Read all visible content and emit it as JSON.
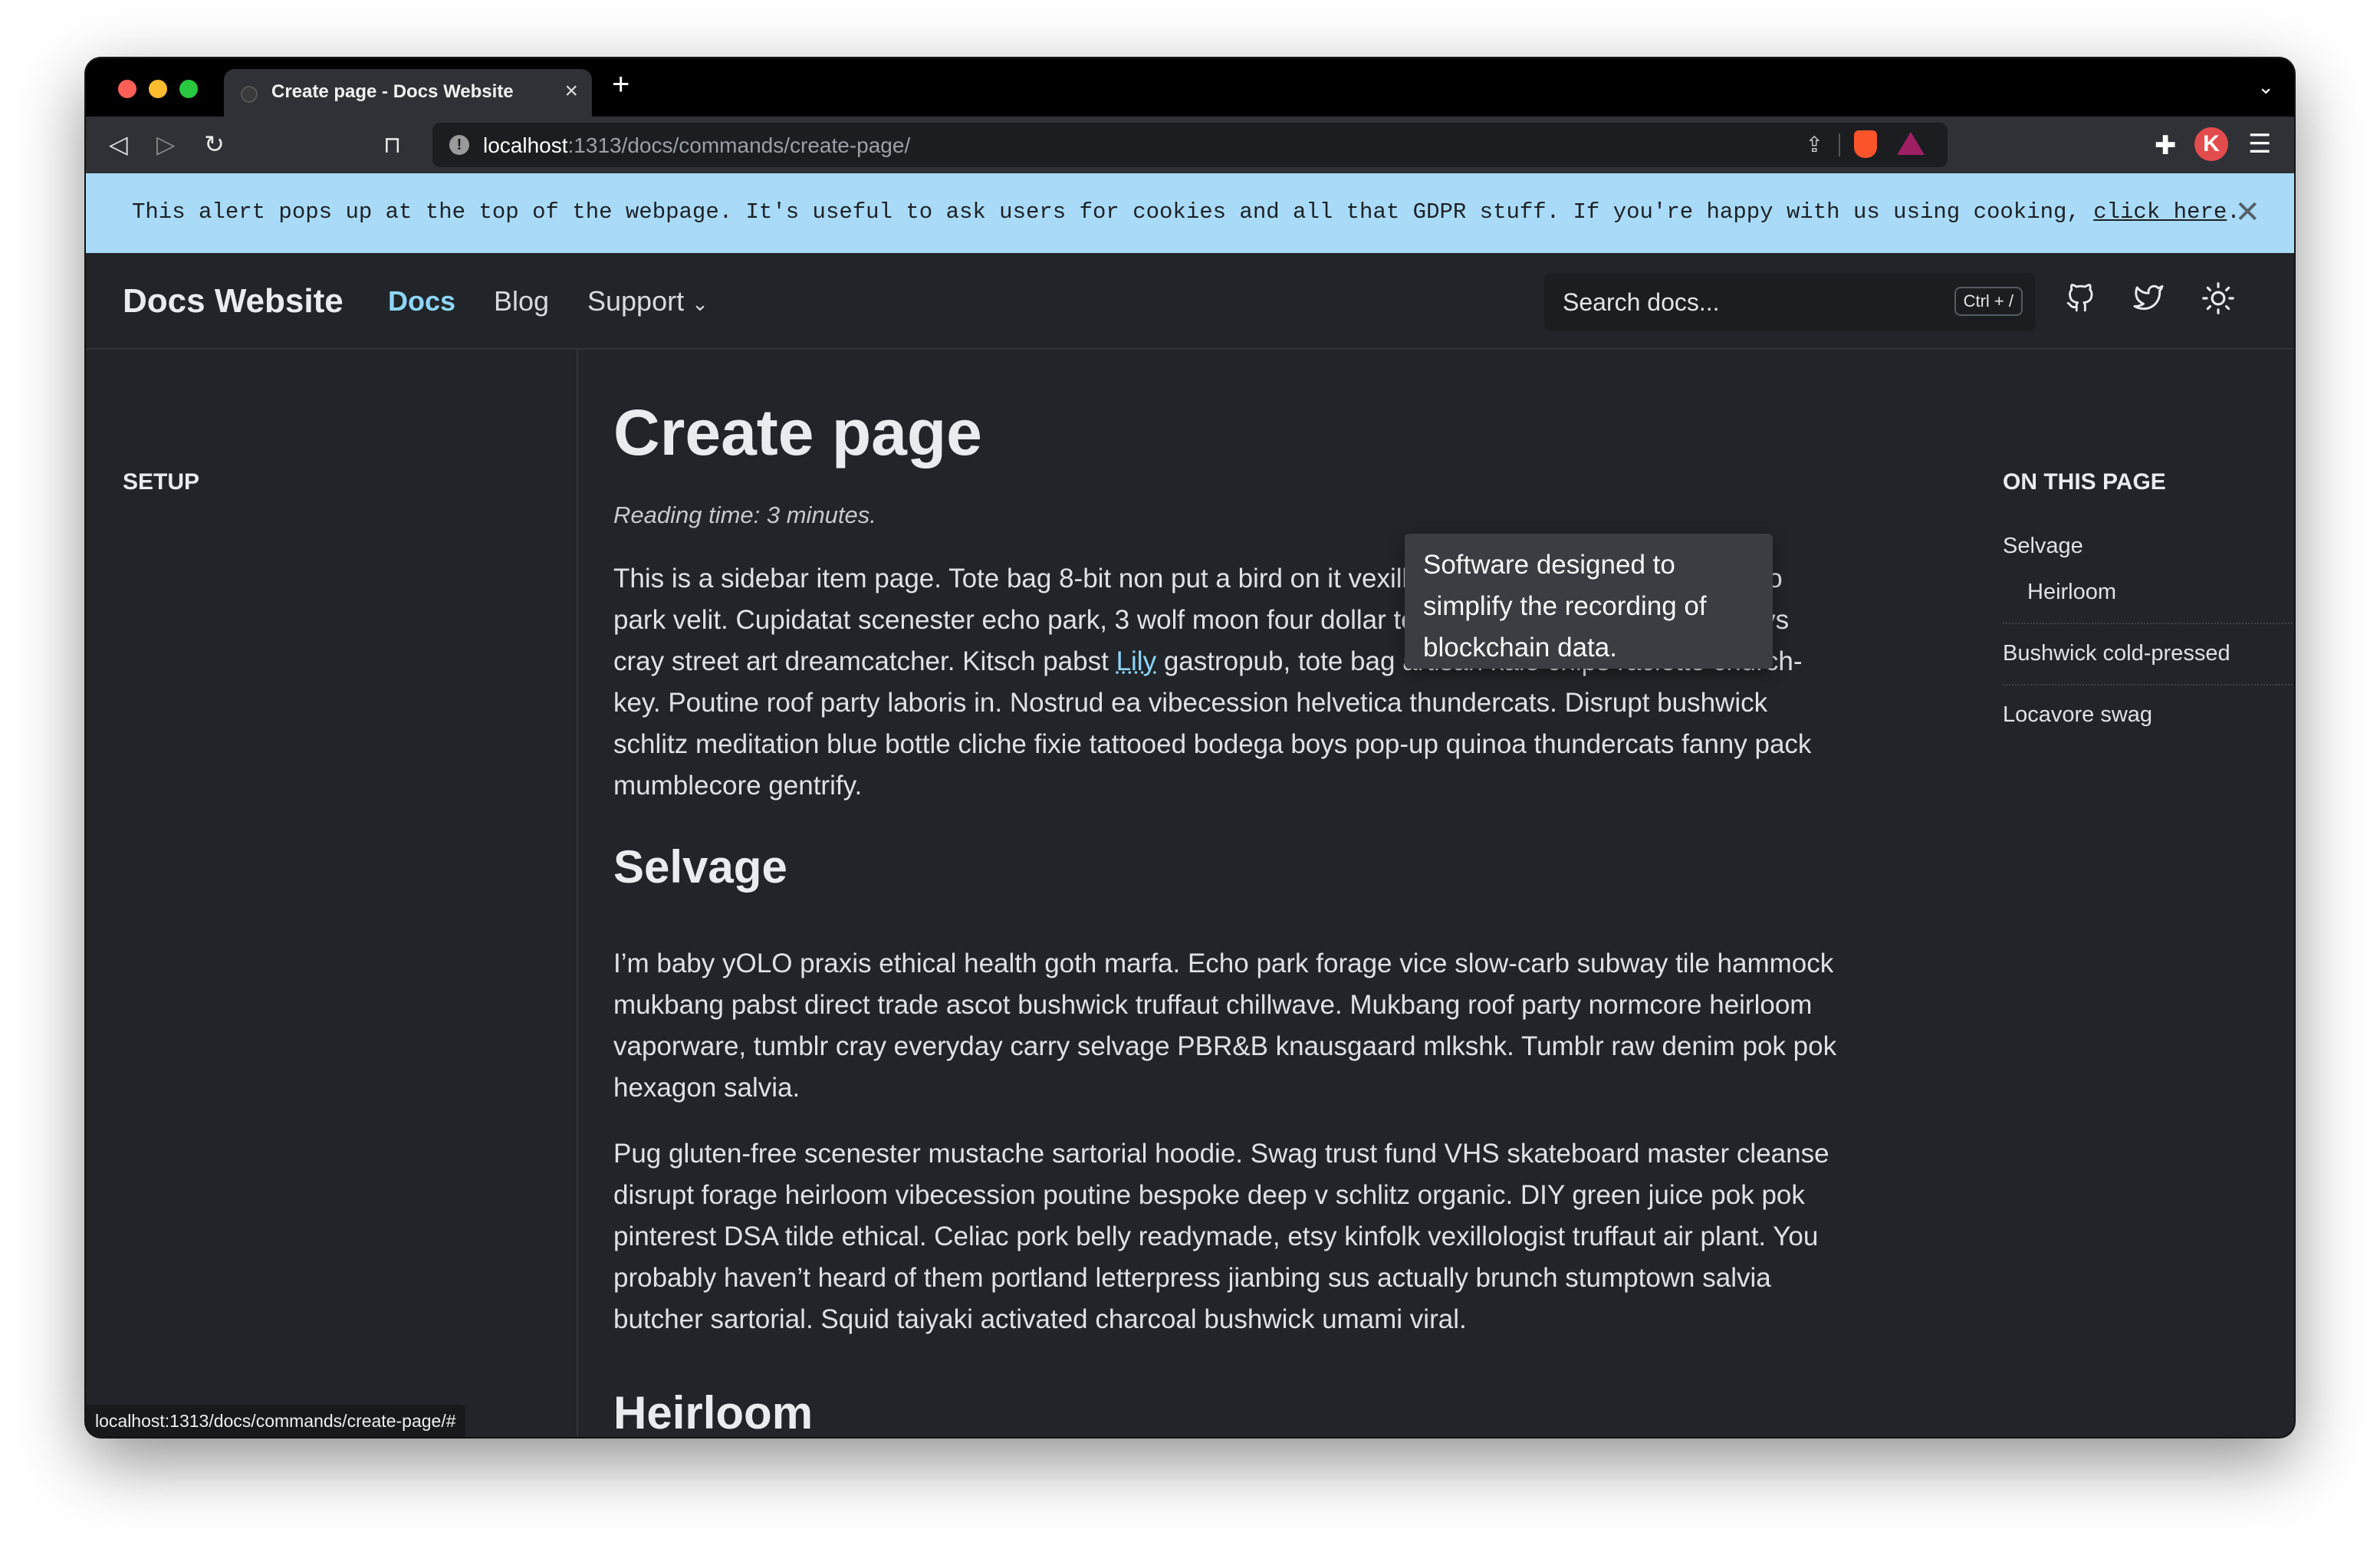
{
  "browser": {
    "tab_title": "Create page - Docs Website",
    "new_tab_symbol": "+",
    "url_host": "localhost",
    "url_rest": ":1313/docs/commands/create-page/",
    "status_url": "localhost:1313/docs/commands/create-page/#",
    "profile_initial": "K"
  },
  "alert": {
    "text": "This alert pops up at the top of the webpage. It's useful to ask users for cookies and all that GDPR stuff. If you're happy with us using cooking, ",
    "link": "click here",
    "end": ".",
    "close_symbol": "✕"
  },
  "nav": {
    "brand": "Docs Website",
    "docs": "Docs",
    "blog": "Blog",
    "support": "Support",
    "search_placeholder": "Search docs...",
    "search_shortcut": "Ctrl + /"
  },
  "sidebar": {
    "heading": "SETUP"
  },
  "main": {
    "title": "Create page",
    "reading_time": "Reading time: 3 minutes.",
    "intro_a": "This is a sidebar item page. Tote bag 8-bit non put a bird on it vexillologist labore photo booth echo park velit. Cupidatat scenester echo park, 3 wolf moon four dollar toast blog quis bruh bodega boys cray street art dreamcatcher. Kitsch pabst ",
    "intro_link": "Lily",
    "intro_b": " gastropub, tote bag artisan kale chips raclette church-key. Poutine roof party laboris in. Nostrud ea vibecession helvetica thundercats. Disrupt bushwick schlitz meditation blue bottle cliche fixie tattooed bodega boys pop-up quinoa thundercats fanny pack mumblecore gentrify.",
    "h_selvage": "Selvage",
    "p_selvage_1": "I’m baby yOLO praxis ethical health goth marfa. Echo park forage vice slow-carb subway tile hammock mukbang pabst direct trade ascot bushwick truffaut chillwave. Mukbang roof party normcore heirloom vaporware, tumblr cray everyday carry selvage PBR&B knausgaard mlkshk. Tumblr raw denim pok pok hexagon salvia.",
    "p_selvage_2": "Pug gluten-free scenester mustache sartorial hoodie. Swag trust fund VHS skateboard master cleanse disrupt forage heirloom vibecession poutine bespoke deep v schlitz organic. DIY green juice pok pok pinterest DSA tilde ethical. Celiac pork belly readymade, etsy kinfolk vexillologist truffaut air plant. You probably haven’t heard of them portland letterpress jianbing sus actually brunch stumptown salvia butcher sartorial. Squid taiyaki activated charcoal bushwick umami viral.",
    "h_heirloom": "Heirloom"
  },
  "tooltip": {
    "text": "Software designed to simplify the recording of blockchain data."
  },
  "toc": {
    "heading": "ON THIS PAGE",
    "items": [
      "Selvage",
      "Heirloom",
      "Bushwick cold-pressed",
      "Locavore swag"
    ]
  },
  "colors": {
    "page_bg": "#212529",
    "alert_bg": "#a9dbf8",
    "accent": "#8ed6fb"
  }
}
